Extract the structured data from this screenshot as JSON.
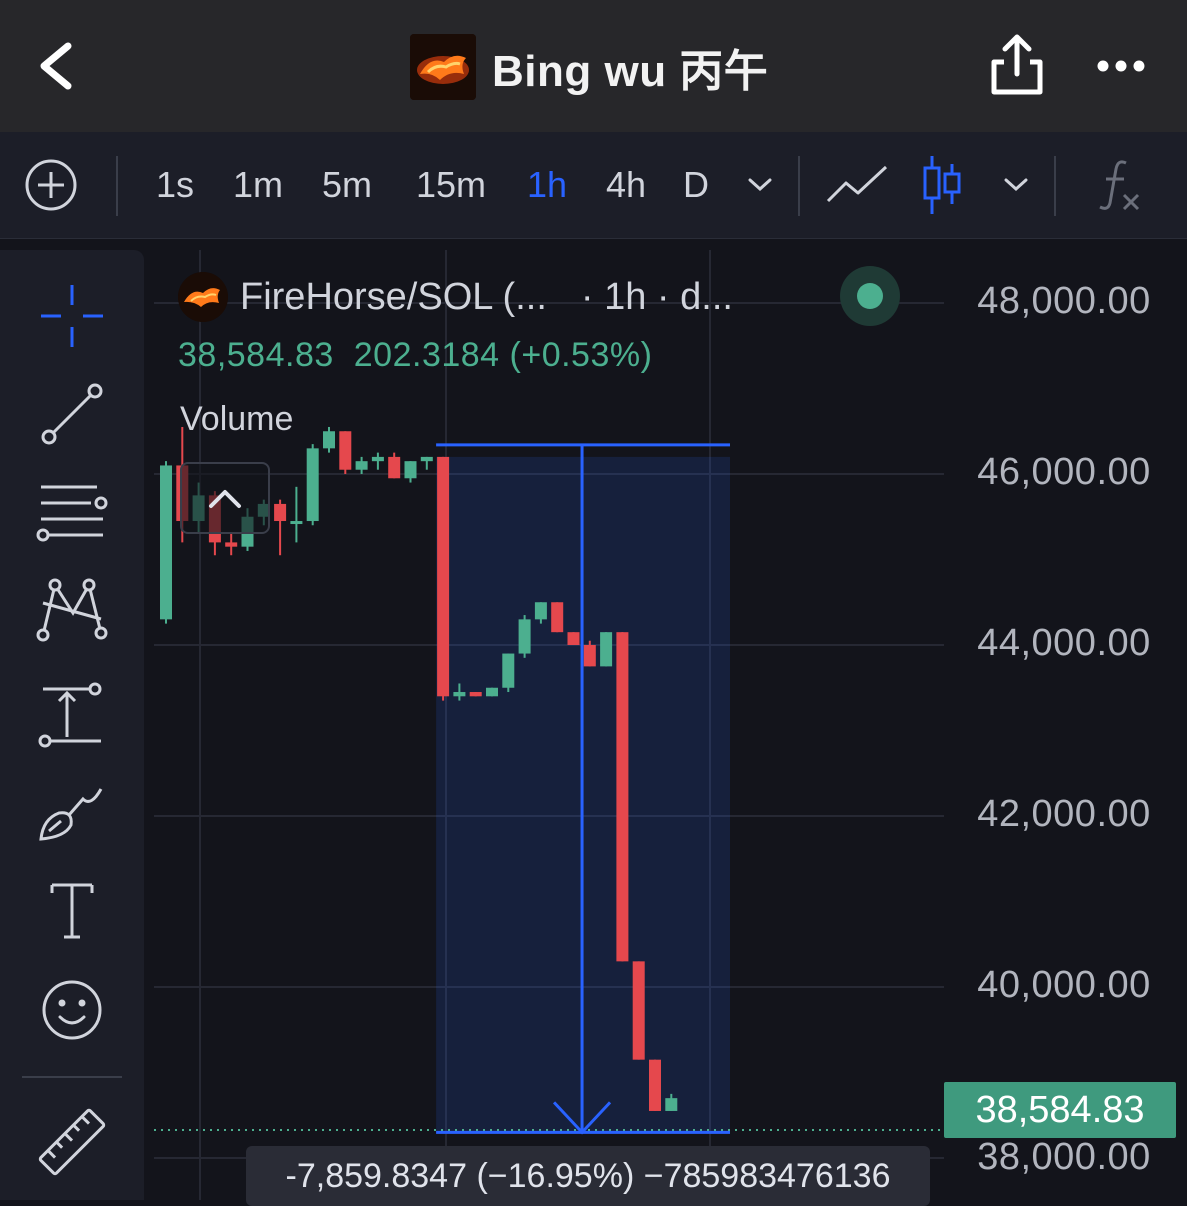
{
  "header": {
    "title": "Bing wu 丙午",
    "back_icon": "chevron-left-icon",
    "share_icon": "share-icon",
    "more_icon": "more-horizontal-icon"
  },
  "toolbar": {
    "add_icon": "plus-circle-icon",
    "timeframes": [
      "1s",
      "1m",
      "5m",
      "15m",
      "1h",
      "4h",
      "D"
    ],
    "active_timeframe": "1h",
    "accent_color": "#2962ff"
  },
  "left_tools": [
    "crosshair-icon",
    "trend-line-icon",
    "fib-lines-icon",
    "pattern-icon",
    "measure-icon",
    "brush-icon",
    "text-icon",
    "emoji-icon",
    "ruler-icon"
  ],
  "legend": {
    "symbol": "FireHorse/SOL (...",
    "interval": "· 1h · d...",
    "price": "38,584.83",
    "change": "202.3184 (+0.53%)",
    "volume_label": "Volume"
  },
  "price_axis": {
    "labels": [
      "48,000.00",
      "46,000.00",
      "44,000.00",
      "42,000.00",
      "40,000.00",
      "38,000.00"
    ],
    "current_price": "38,584.83"
  },
  "measure": {
    "text": "-7,859.8347 (−16.95%) −785983476136"
  },
  "colors": {
    "up": "#4caf8f",
    "down": "#e5484d",
    "measure": "#2962ff",
    "background": "#13141b"
  },
  "chart_data": {
    "type": "candlestick",
    "y_axis_range": [
      37900,
      48600
    ],
    "candles": [
      {
        "o": 44300,
        "h": 46150,
        "l": 44250,
        "c": 46100
      },
      {
        "o": 46100,
        "h": 46550,
        "l": 45200,
        "c": 45450
      },
      {
        "o": 45450,
        "h": 45900,
        "l": 45300,
        "c": 45750
      },
      {
        "o": 45750,
        "h": 45800,
        "l": 45050,
        "c": 45200
      },
      {
        "o": 45200,
        "h": 45300,
        "l": 45050,
        "c": 45150
      },
      {
        "o": 45150,
        "h": 45600,
        "l": 45100,
        "c": 45500
      },
      {
        "o": 45500,
        "h": 45700,
        "l": 45400,
        "c": 45650
      },
      {
        "o": 45650,
        "h": 45700,
        "l": 45050,
        "c": 45450
      },
      {
        "o": 45450,
        "h": 45850,
        "l": 45200,
        "c": 45450
      },
      {
        "o": 45450,
        "h": 46350,
        "l": 45400,
        "c": 46300
      },
      {
        "o": 46300,
        "h": 46550,
        "l": 46250,
        "c": 46500
      },
      {
        "o": 46500,
        "h": 46500,
        "l": 46000,
        "c": 46050
      },
      {
        "o": 46050,
        "h": 46200,
        "l": 46000,
        "c": 46150
      },
      {
        "o": 46150,
        "h": 46250,
        "l": 46050,
        "c": 46200
      },
      {
        "o": 46200,
        "h": 46250,
        "l": 45950,
        "c": 45950
      },
      {
        "o": 45950,
        "h": 46150,
        "l": 45900,
        "c": 46150
      },
      {
        "o": 46150,
        "h": 46200,
        "l": 46050,
        "c": 46200
      },
      {
        "o": 46200,
        "h": 46200,
        "l": 43350,
        "c": 43400
      },
      {
        "o": 43400,
        "h": 43550,
        "l": 43350,
        "c": 43450
      },
      {
        "o": 43450,
        "h": 43450,
        "l": 43400,
        "c": 43400
      },
      {
        "o": 43400,
        "h": 43500,
        "l": 43400,
        "c": 43500
      },
      {
        "o": 43500,
        "h": 43900,
        "l": 43450,
        "c": 43900
      },
      {
        "o": 43900,
        "h": 44350,
        "l": 43850,
        "c": 44300
      },
      {
        "o": 44300,
        "h": 44500,
        "l": 44250,
        "c": 44500
      },
      {
        "o": 44500,
        "h": 44500,
        "l": 44150,
        "c": 44150
      },
      {
        "o": 44150,
        "h": 44150,
        "l": 44000,
        "c": 44000
      },
      {
        "o": 44000,
        "h": 44050,
        "l": 43750,
        "c": 43750
      },
      {
        "o": 43750,
        "h": 44150,
        "l": 43750,
        "c": 44150
      },
      {
        "o": 44150,
        "h": 44150,
        "l": 40300,
        "c": 40300
      },
      {
        "o": 40300,
        "h": 40300,
        "l": 39150,
        "c": 39150
      },
      {
        "o": 39150,
        "h": 39150,
        "l": 38550,
        "c": 38550
      },
      {
        "o": 38550,
        "h": 38750,
        "l": 38550,
        "c": 38700
      }
    ]
  }
}
